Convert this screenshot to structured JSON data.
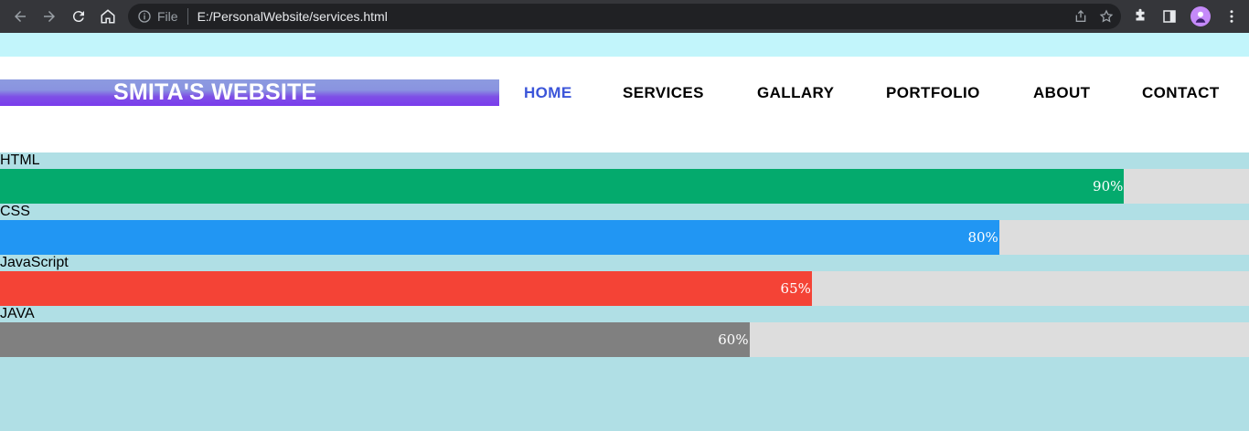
{
  "browser": {
    "file_label": "File",
    "url": "E:/PersonalWebsite/services.html",
    "colors": {
      "chrome": "#35363a",
      "omnibox": "#202124"
    },
    "icons": [
      "back-icon",
      "forward-icon",
      "reload-icon",
      "home-icon",
      "info-icon",
      "share-icon",
      "star-icon",
      "extensions-icon",
      "side-panel-icon",
      "profile-avatar",
      "menu-icon"
    ]
  },
  "site": {
    "logo_text": "SMITA'S WEBSITE",
    "nav": [
      {
        "label": "HOME",
        "active": true
      },
      {
        "label": "SERVICES",
        "active": false
      },
      {
        "label": "GALLARY",
        "active": false
      },
      {
        "label": "PORTFOLIO",
        "active": false
      },
      {
        "label": "ABOUT",
        "active": false
      },
      {
        "label": "CONTACT",
        "active": false
      }
    ],
    "colors": {
      "active_nav": "#3b55d9",
      "page_bg": "#b0dfe5",
      "strip": "#c2f5fb",
      "track": "#dddddd"
    }
  },
  "skills": [
    {
      "label": "HTML",
      "percent_text": "90%",
      "percent": 90,
      "color": "#04aa6d"
    },
    {
      "label": "CSS",
      "percent_text": "80%",
      "percent": 80,
      "color": "#2196f3"
    },
    {
      "label": "JavaScript",
      "percent_text": "65%",
      "percent": 65,
      "color": "#f44336"
    },
    {
      "label": "JAVA",
      "percent_text": "60%",
      "percent": 60,
      "color": "#808080"
    }
  ]
}
